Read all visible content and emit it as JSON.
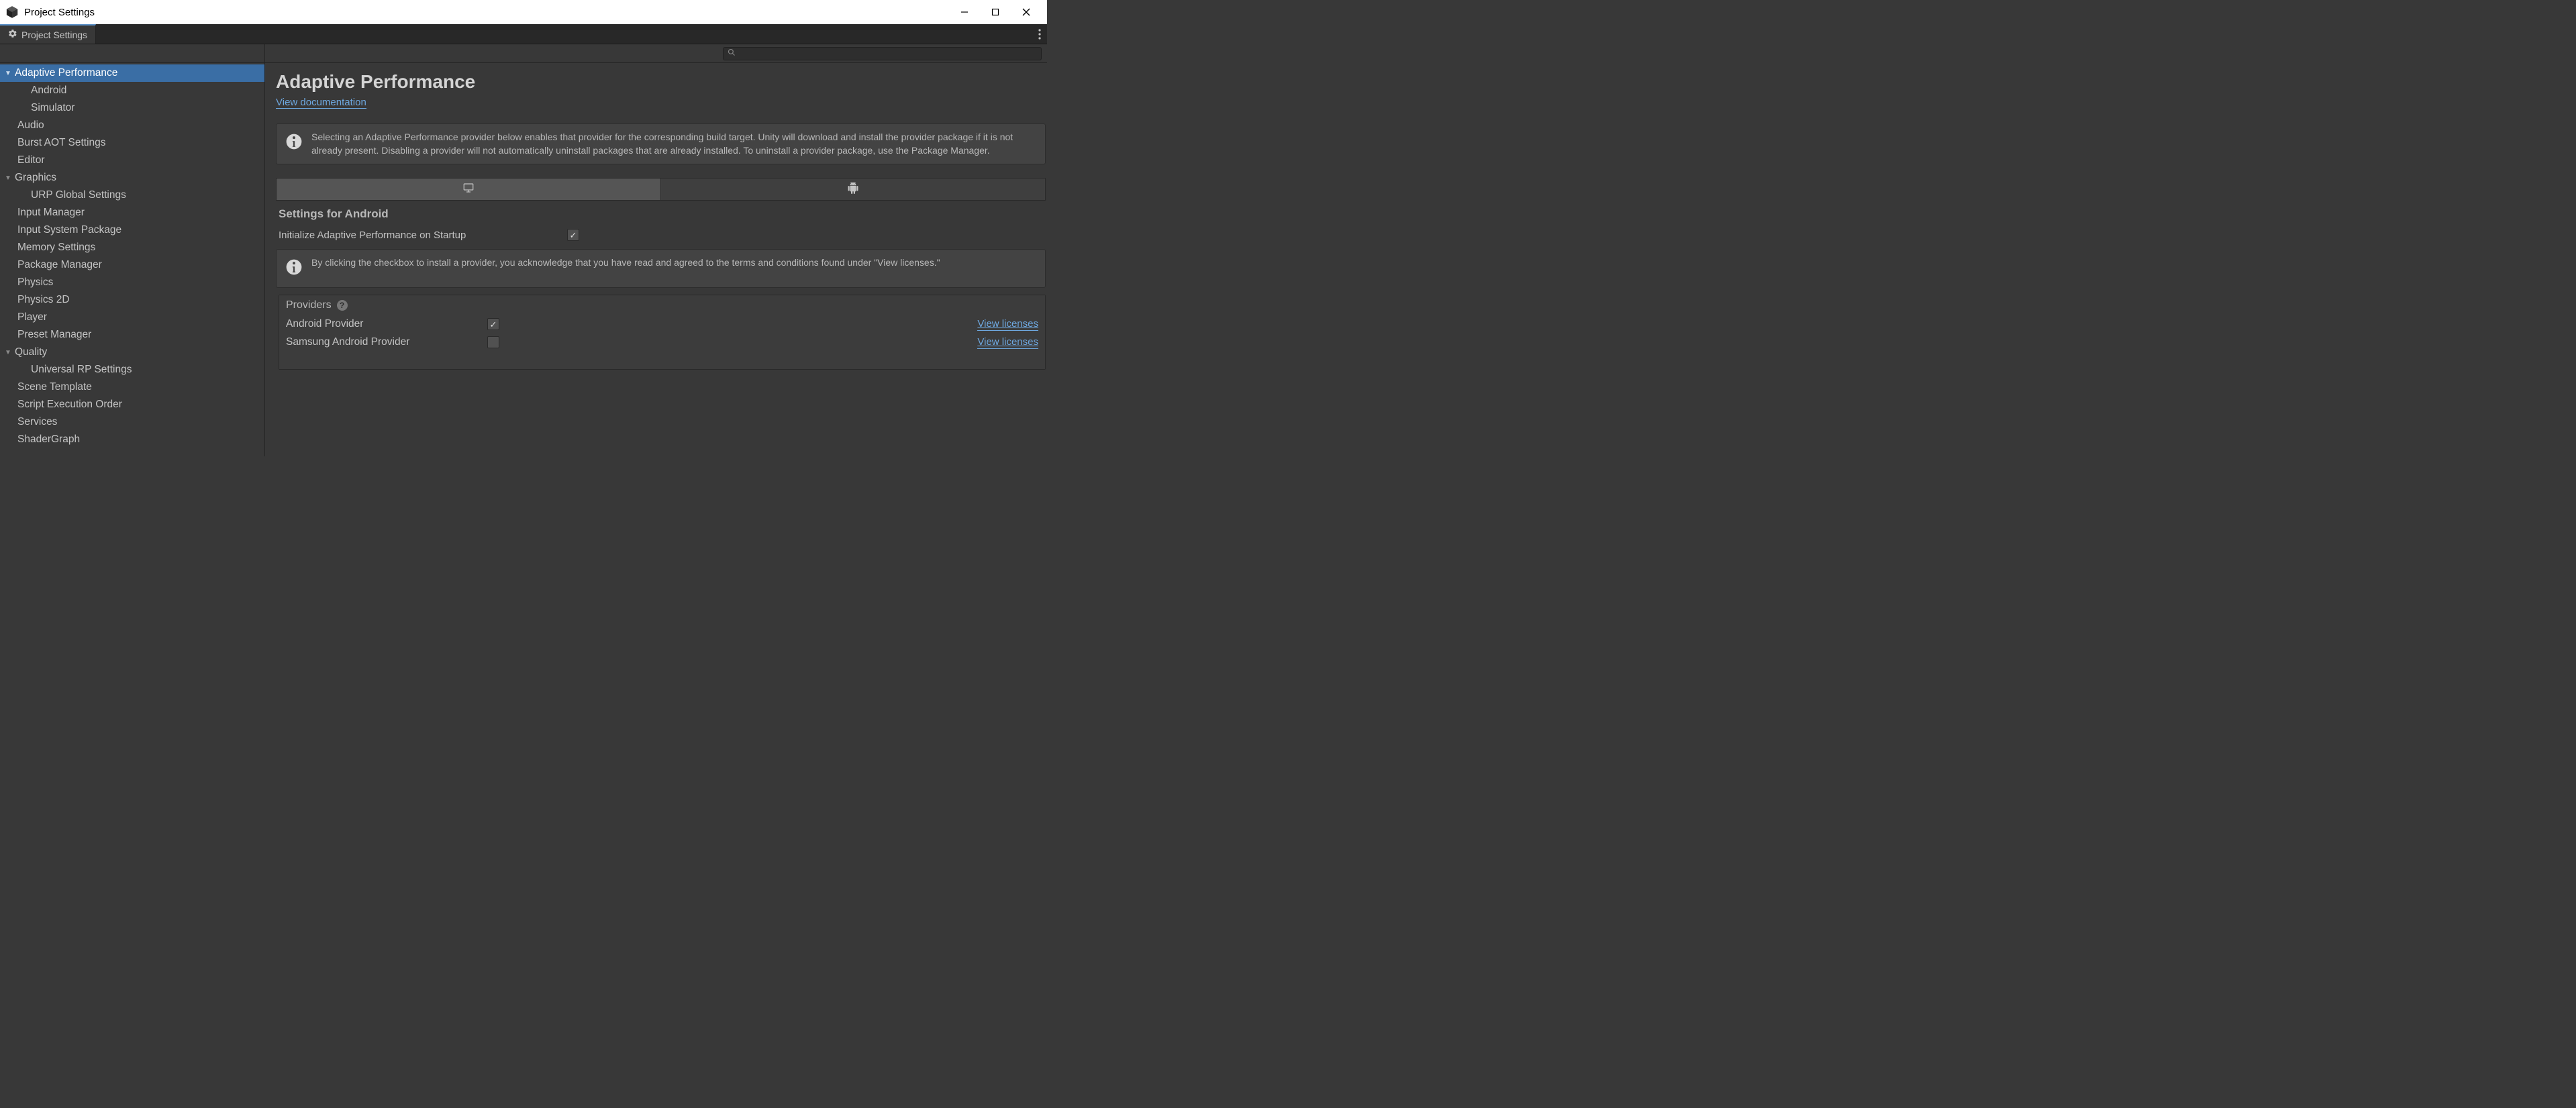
{
  "window": {
    "title": "Project Settings"
  },
  "tab": {
    "label": "Project Settings"
  },
  "search": {
    "placeholder": ""
  },
  "sidebar": {
    "items": [
      {
        "label": "Adaptive Performance",
        "type": "expandable",
        "selected": true
      },
      {
        "label": "Android",
        "type": "child"
      },
      {
        "label": "Simulator",
        "type": "child"
      },
      {
        "label": "Audio",
        "type": "top"
      },
      {
        "label": "Burst AOT Settings",
        "type": "top"
      },
      {
        "label": "Editor",
        "type": "top"
      },
      {
        "label": "Graphics",
        "type": "expandable"
      },
      {
        "label": "URP Global Settings",
        "type": "child"
      },
      {
        "label": "Input Manager",
        "type": "top"
      },
      {
        "label": "Input System Package",
        "type": "top"
      },
      {
        "label": "Memory Settings",
        "type": "top"
      },
      {
        "label": "Package Manager",
        "type": "top"
      },
      {
        "label": "Physics",
        "type": "top"
      },
      {
        "label": "Physics 2D",
        "type": "top"
      },
      {
        "label": "Player",
        "type": "top"
      },
      {
        "label": "Preset Manager",
        "type": "top"
      },
      {
        "label": "Quality",
        "type": "expandable"
      },
      {
        "label": "Universal RP Settings",
        "type": "child"
      },
      {
        "label": "Scene Template",
        "type": "top"
      },
      {
        "label": "Script Execution Order",
        "type": "top"
      },
      {
        "label": "Services",
        "type": "top"
      },
      {
        "label": "ShaderGraph",
        "type": "top"
      }
    ]
  },
  "content": {
    "heading": "Adaptive Performance",
    "doc_link_label": "View documentation",
    "info1": "Selecting an Adaptive Performance provider below enables that provider for the corresponding build target. Unity will download and install the provider package if it is not already present. Disabling a provider will not automatically uninstall packages that are already installed. To uninstall a provider package, use the Package Manager.",
    "platform_section_title": "Settings for Android",
    "init_label": "Initialize Adaptive Performance on Startup",
    "init_checked": true,
    "info2": "By clicking the checkbox to install a provider, you acknowledge that you have read and agreed to the terms and conditions found under \"View licenses.\"",
    "providers_header": "Providers",
    "providers": [
      {
        "name": "Android Provider",
        "checked": true,
        "link": "View licenses"
      },
      {
        "name": "Samsung Android Provider",
        "checked": false,
        "link": "View licenses"
      }
    ]
  }
}
